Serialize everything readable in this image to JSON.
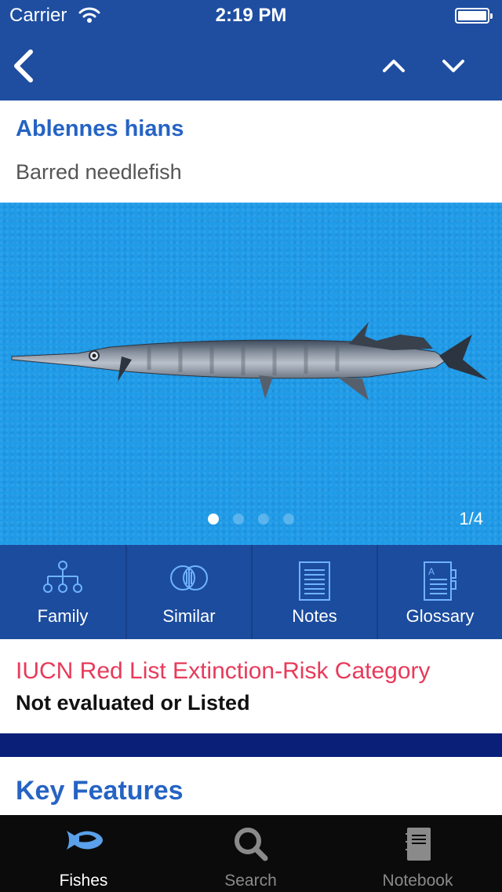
{
  "status": {
    "carrier": "Carrier",
    "time": "2:19 PM"
  },
  "species": {
    "scientific_name": "Ablennes hians",
    "common_name": "Barred needlefish"
  },
  "gallery": {
    "counter": "1/4",
    "total_pages": 4,
    "current_page": 1
  },
  "toolbar": {
    "items": [
      {
        "label": "Family"
      },
      {
        "label": "Similar"
      },
      {
        "label": "Notes"
      },
      {
        "label": "Glossary"
      }
    ]
  },
  "iucn": {
    "title": "IUCN Red List Extinction-Risk Category",
    "value": "Not evaluated or Listed"
  },
  "section": {
    "title": "Key Features"
  },
  "tabs": [
    {
      "label": "Fishes"
    },
    {
      "label": "Search"
    },
    {
      "label": "Notebook"
    }
  ],
  "colors": {
    "header": "#1f4ea1",
    "accent": "#2563c4",
    "iucn": "#e83a5a",
    "gallery_bg": "#1f9be8",
    "active_tab": "#ffffff",
    "inactive_tab": "#8a8a8a"
  }
}
